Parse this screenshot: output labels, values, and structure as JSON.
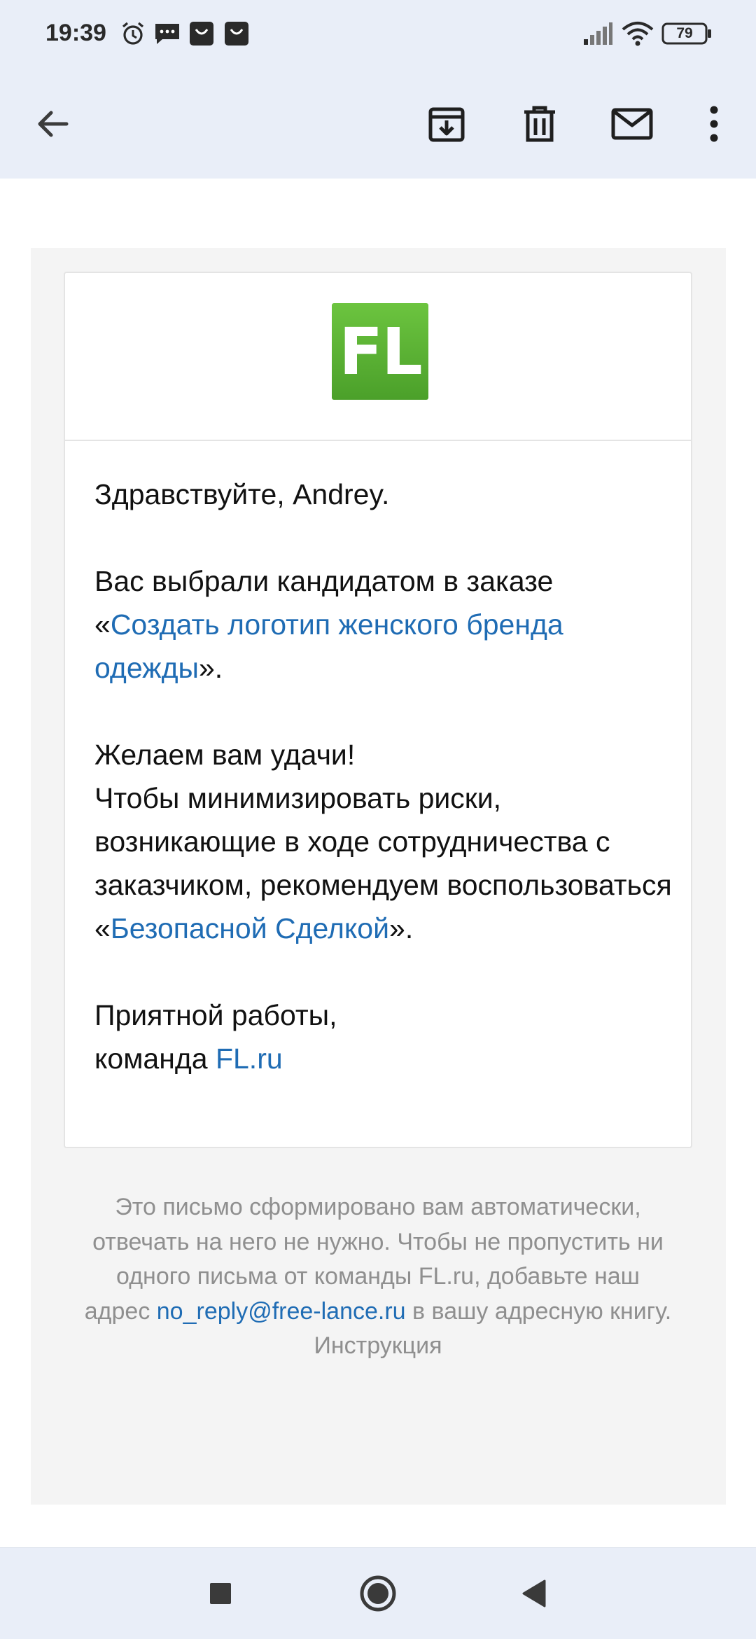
{
  "status_bar": {
    "time": "19:39",
    "battery": "79",
    "icons": [
      "alarm-icon",
      "messages-icon",
      "shopping-bag-icon",
      "shopping-bag-icon",
      "signal-icon",
      "wifi-icon",
      "battery-icon"
    ]
  },
  "toolbar": {
    "icons": [
      "back-arrow-icon",
      "archive-icon",
      "trash-icon",
      "mark-unread-icon",
      "more-vert-icon"
    ]
  },
  "email": {
    "logo_text": "FL",
    "greeting": "Здравствуйте, Andrey.",
    "p2_text": "Вас выбрали кандидатом в заказе «",
    "p2_link": "Создать логотип женского бренда одежды",
    "p2_end": "».",
    "p3_line1": "Желаем вам удачи!",
    "p3_text": "Чтобы минимизировать риски, возникающие в ходе сотрудничества с заказчиком, рекомендуем воспользоваться «",
    "p3_link": "Безопасной Сделкой",
    "p3_end": "».",
    "closing": "Приятной работы,",
    "team_text": "команда ",
    "team_link": "FL.ru"
  },
  "footer": {
    "text": "Это письмо сформировано вам автоматически, отвечать на него не нужно. Чтобы не пропустить ни одного письма от команды FL.ru, добавьте наш адрес ",
    "email_link": "no_reply@free-lance.ru",
    "text_after": " в вашу адресную книгу.",
    "instruction": "Инструкция"
  },
  "colors": {
    "link": "#1f6cb4",
    "bar_bg": "#e9eef8",
    "mail_bg": "#f4f4f4",
    "logo_green": "#5bb334"
  },
  "nav_bar": {
    "icons": [
      "recents-square-icon",
      "home-circle-icon",
      "back-triangle-icon"
    ]
  }
}
